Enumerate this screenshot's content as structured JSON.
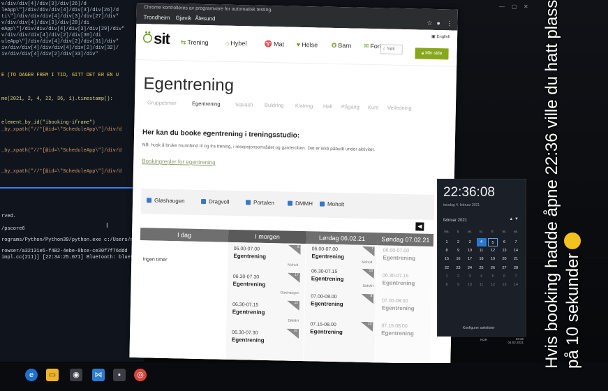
{
  "ide": {
    "code_lines": [
      "v/div/div[4]/div[3]/div[26]/d",
      "leApp\\\"]/div/div/div[4]/div[3]/div[26]/d",
      "ti\\\"]/div/div/div[4]/div[3]/div[27]/div\"",
      "v/div/div[4]/div[3]/div[28]/di",
      "eApp\\\"]/div/div/div[4]/div[3]/div[29]/div\"",
      "v/div/div/div[4]/div[2]/div[30]/di",
      "uleApp\\\"]/div/div[4]/div[2]/div[31]/div\"",
      "iv/div/div[4]/div/div[4]/div[2]/div[32]/",
      "iv/div/div[4]/div[2]/div[33]/div\""
    ],
    "comment": "E (TO DAGER FREM I TID, GITT DET ER EN U",
    "timestamp_line": "me(2021, 2, 4, 22, 36, 1).timestamp():",
    "iframe_line": "element_by_id(\"ibooking-iframe\")",
    "xpath_lines": [
      "_by_xpath(\"//*[@id=\\\"ScheduleApp\\\"]/div/d",
      "_by_xpath(\"//*[@id=\\\"ScheduleApp\\\"]/div/d",
      "_by_xpath(\"//*[@id=\\\"ScheduleApp\\\"]/div/d"
    ],
    "terminal_lines": [
      "rved.",
      "/pscore6",
      "rograms/Python/Python39/python.exe c:/Users/mi",
      "rowser/a32131e5-f4B2-4ebe-8bce-ce30f7f76ddd",
      "impl.cc(211)] [22:34:25.071] Bluetooth: bluet"
    ]
  },
  "browser": {
    "notice": "Chrome kontrolleres av programvare for automatisk testing.",
    "bookmarks": [
      "Trondheim",
      "Gjøvik",
      "Ålesund"
    ]
  },
  "site": {
    "logo": "sit",
    "nav": [
      "Trening",
      "Hybel",
      "Mat",
      "Helse",
      "Barn",
      "Fori"
    ],
    "search": "Søk",
    "english": "English",
    "my_page": "Min side",
    "title": "Egentrening",
    "tabs": [
      "Gruppetimer",
      "Egentrening",
      "Squash",
      "Buldring",
      "Klatring",
      "Hall",
      "Pågang",
      "Kurs",
      "Veiledning"
    ],
    "intro": "Her kan du booke egentrening i treningsstudio:",
    "note": "NB: husk å bruke munnbind til og fra trening, i resepsjonsområdet og garderoben. Det er ikke påbudt under aktivitet.",
    "rules_link": "Bookingregler for egentrening",
    "filters": [
      "Gløshaugen",
      "Dragvoll",
      "Portalen",
      "DMMH",
      "Moholt"
    ]
  },
  "schedule": {
    "columns": [
      "I dag",
      "I morgen",
      "Lørdag 06.02.21",
      "Søndag 07.02.21"
    ],
    "today_text": "Ingen timer",
    "tomorrow": [
      {
        "time": "06.00-07.00",
        "name": "Egentrening",
        "count": "8",
        "loc": "Moholt"
      },
      {
        "time": "06.30-07.30",
        "name": "Egentrening",
        "count": "17",
        "loc": "Gløshaugen"
      },
      {
        "time": "06.30-07.15",
        "name": "Egentrening",
        "count": "12",
        "loc": "DMMH"
      },
      {
        "time": "06.30-07.30",
        "name": "Egentrening",
        "count": "10",
        "loc": ""
      }
    ],
    "saturday": [
      {
        "time": "06.00-07.00",
        "name": "Egentrening",
        "count": "7",
        "loc": "Moholt"
      },
      {
        "time": "06.30-07.15",
        "name": "Egentrening",
        "count": "13",
        "loc": "DMMH"
      },
      {
        "time": "07.00-08.00",
        "name": "Egentrening",
        "count": "8",
        "loc": ""
      },
      {
        "time": "07.15-08.00",
        "name": "Egentrening",
        "count": "13",
        "loc": ""
      }
    ],
    "sunday": [
      {
        "time": "06.00-07.00",
        "name": "Egentrening",
        "count": "",
        "loc": ""
      },
      {
        "time": "06.30-07.15",
        "name": "Egentrening",
        "count": "",
        "loc": ""
      },
      {
        "time": "07.00-08.00",
        "name": "Egentrening",
        "count": "",
        "loc": ""
      },
      {
        "time": "07.15-08.00",
        "name": "Egentrening",
        "count": "",
        "loc": ""
      }
    ]
  },
  "calendar": {
    "time": "22:36:08",
    "date": "torsdag 4. februar 2021",
    "month": "februar 2021",
    "weekdays": [
      "ma.",
      "ti.",
      "on.",
      "to.",
      "fr.",
      "lø.",
      "sø."
    ],
    "days": [
      "1",
      "2",
      "3",
      "4",
      "5",
      "6",
      "7",
      "8",
      "9",
      "10",
      "11",
      "12",
      "13",
      "14",
      "15",
      "16",
      "17",
      "18",
      "19",
      "20",
      "21",
      "22",
      "23",
      "24",
      "25",
      "26",
      "27",
      "28",
      "1",
      "2",
      "3",
      "4",
      "5",
      "6",
      "7",
      "8",
      "9",
      "10",
      "11",
      "12",
      "13",
      "14"
    ],
    "today_index": 3,
    "footer": "Konfigurer søkelister",
    "tray_time": "22:36",
    "tray_date": "04.02.2021",
    "tray_lang": "NOR"
  },
  "caption": {
    "text": "Hvis booking hadde åpne 22:36 ville du hatt plass på 10 sekunder"
  }
}
